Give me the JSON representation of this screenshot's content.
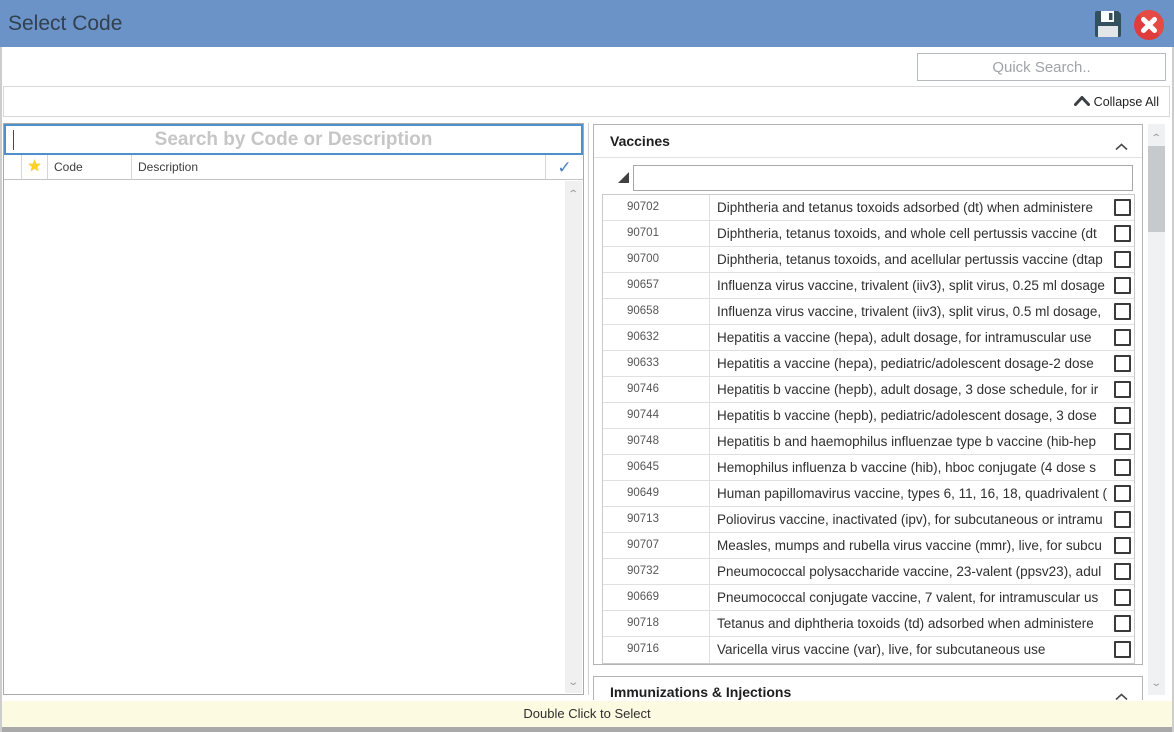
{
  "window": {
    "title": "Select Code"
  },
  "header": {
    "quick_search_placeholder": "Quick Search..",
    "collapse_all_label": "Collapse All"
  },
  "left_panel": {
    "search_placeholder": "Search by Code or Description",
    "columns": {
      "star": "favorite",
      "code": "Code",
      "description": "Description",
      "check": "selected"
    },
    "results": []
  },
  "right_panel": {
    "groups": [
      {
        "title": "Vaccines",
        "filter_value": "",
        "rows": [
          {
            "code": "90702",
            "description": "Diphtheria and tetanus toxoids adsorbed (dt) when administere",
            "checked": false
          },
          {
            "code": "90701",
            "description": "Diphtheria, tetanus toxoids, and whole cell pertussis vaccine (dt",
            "checked": false
          },
          {
            "code": "90700",
            "description": "Diphtheria, tetanus toxoids, and acellular pertussis vaccine (dtap",
            "checked": false
          },
          {
            "code": "90657",
            "description": "Influenza virus vaccine, trivalent (iiv3), split virus, 0.25 ml dosage",
            "checked": false
          },
          {
            "code": "90658",
            "description": "Influenza virus vaccine, trivalent (iiv3), split virus, 0.5 ml dosage,",
            "checked": false
          },
          {
            "code": "90632",
            "description": "Hepatitis a vaccine (hepa), adult dosage, for intramuscular use",
            "checked": false
          },
          {
            "code": "90633",
            "description": "Hepatitis a vaccine (hepa), pediatric/adolescent dosage-2 dose",
            "checked": false
          },
          {
            "code": "90746",
            "description": "Hepatitis b vaccine (hepb), adult dosage, 3 dose schedule, for ir",
            "checked": false
          },
          {
            "code": "90744",
            "description": "Hepatitis b vaccine (hepb), pediatric/adolescent dosage, 3 dose",
            "checked": false
          },
          {
            "code": "90748",
            "description": "Hepatitis b and haemophilus influenzae type b vaccine (hib-hep",
            "checked": false
          },
          {
            "code": "90645",
            "description": "Hemophilus influenza b vaccine (hib), hboc conjugate (4 dose s",
            "checked": false
          },
          {
            "code": "90649",
            "description": "Human papillomavirus vaccine, types 6, 11, 16, 18, quadrivalent (",
            "checked": false
          },
          {
            "code": "90713",
            "description": "Poliovirus vaccine, inactivated (ipv), for subcutaneous or intramu",
            "checked": false
          },
          {
            "code": "90707",
            "description": "Measles, mumps and rubella virus vaccine (mmr), live, for subcu",
            "checked": false
          },
          {
            "code": "90732",
            "description": "Pneumococcal polysaccharide vaccine, 23-valent (ppsv23), adul",
            "checked": false
          },
          {
            "code": "90669",
            "description": "Pneumococcal conjugate vaccine, 7 valent, for intramuscular us",
            "checked": false
          },
          {
            "code": "90718",
            "description": "Tetanus and diphtheria toxoids (td) adsorbed when administere",
            "checked": false
          },
          {
            "code": "90716",
            "description": "Varicella virus vaccine (var), live, for subcutaneous use",
            "checked": false
          }
        ]
      },
      {
        "title": "Immunizations & Injections"
      }
    ]
  },
  "footer": {
    "hint": "Double Click to Select"
  },
  "colors": {
    "titlebar_blue": "#6b93c8",
    "close_red": "#e13c3c",
    "save_slate": "#33505f",
    "footer_yellow": "#fcfae1",
    "star_gold": "#ffd21c",
    "check_blue": "#4a7ec0",
    "focus_border_blue": "#4f8fcc"
  }
}
